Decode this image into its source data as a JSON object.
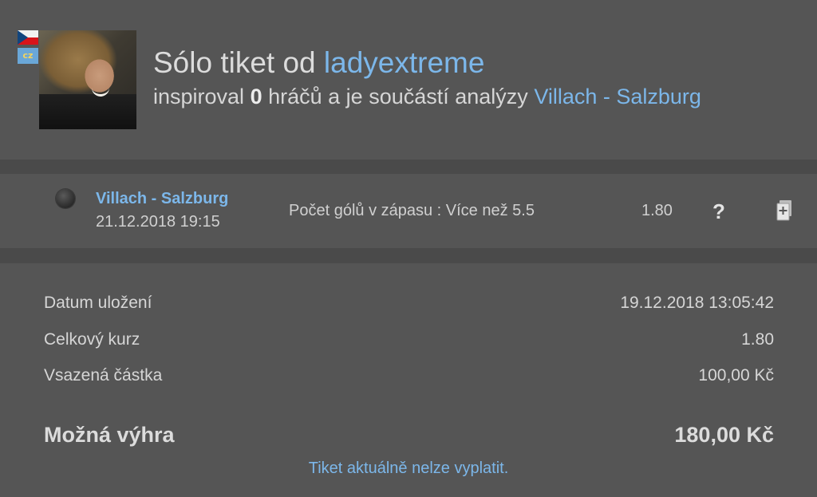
{
  "header": {
    "flag_icon": "czech-flag-icon",
    "lang_badge": "cz",
    "title_prefix": "Sólo tiket od",
    "username": "ladyextreme",
    "sub_prefix": "inspiroval",
    "inspired_count": "0",
    "sub_middle": "hráčů a je součástí analýzy",
    "analysis_link": "Villach - Salzburg"
  },
  "bet": {
    "status_icon": "status-dot-icon",
    "match": "Villach - Salzburg",
    "date": "21.12.2018 19:15",
    "type": "Počet gólů v zápasu : Více než 5.5",
    "odds": "1.80",
    "help_label": "?",
    "copy_icon": "copy-ticket-icon"
  },
  "summary": {
    "rows": [
      {
        "label": "Datum uložení",
        "value": "19.12.2018 13:05:42"
      },
      {
        "label": "Celkový kurz",
        "value": "1.80"
      },
      {
        "label": "Vsazená částka",
        "value": "100,00 Kč"
      }
    ],
    "win_label": "Možná výhra",
    "win_value": "180,00 Kč",
    "payout_note": "Tiket aktuálně nelze vyplatit."
  },
  "colors": {
    "background": "#4a4a4a",
    "panel": "#555555",
    "link": "#7cb7ea",
    "text": "#d6d6d6"
  }
}
